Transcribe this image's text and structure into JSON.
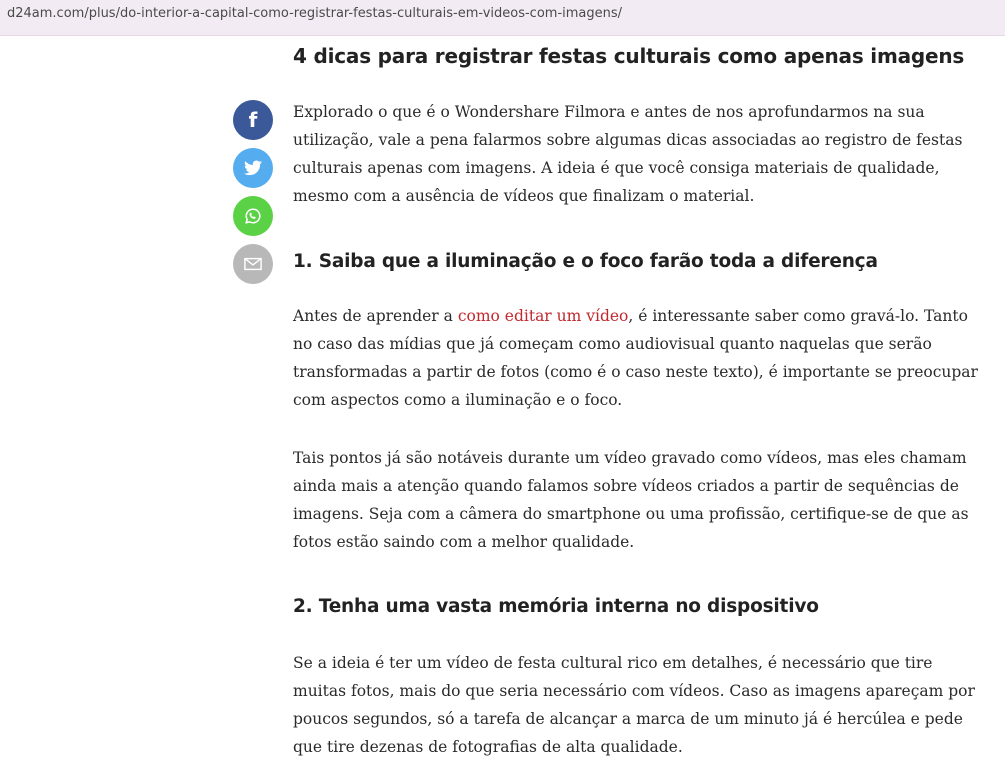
{
  "browser": {
    "url": "d24am.com/plus/do-interior-a-capital-como-registrar-festas-culturais-em-videos-com-imagens/"
  },
  "share": [
    {
      "name": "facebook-icon",
      "glyph": "f",
      "color": "#3b5998"
    },
    {
      "name": "twitter-icon",
      "color": "#55acee"
    },
    {
      "name": "whatsapp-icon",
      "color": "#5bd146"
    },
    {
      "name": "email-icon",
      "color": "#b8b8b8"
    }
  ],
  "article": {
    "heading": "4 dicas para registrar festas culturais como apenas imagens",
    "intro": "Explorado o que é o Wondershare Filmora e antes de nos aprofundarmos na sua utilização, vale a pena falarmos sobre algumas dicas associadas ao registro de festas culturais apenas com imagens. A ideia é que você consiga materiais de qualidade, mesmo com a ausência de vídeos que finalizam o material.",
    "section1": {
      "title": "1. Saiba que a iluminação e o foco farão toda a diferença",
      "p1_before": "Antes de aprender a ",
      "p1_link": "como editar um vídeo",
      "p1_after": ", é interessante saber como gravá-lo. Tanto no caso das mídias que já começam como audiovisual quanto naquelas que serão transformadas a partir de fotos (como é o caso neste texto), é importante se preocupar com aspectos como a iluminação e o foco.",
      "p2": "Tais pontos já são notáveis durante um vídeo gravado como vídeos, mas eles chamam ainda mais a atenção quando falamos sobre vídeos criados a partir de sequências de imagens. Seja com a câmera do smartphone ou uma profissão, certifique-se de que as fotos estão saindo com a melhor qualidade."
    },
    "section2": {
      "title": "2. Tenha uma vasta memória interna no dispositivo",
      "p1": "Se a ideia é ter um vídeo de festa cultural rico em detalhes, é necessário que tire muitas fotos, mais do que seria necessário com vídeos. Caso as imagens apareçam por poucos segundos, só a tarefa de alcançar a marca de um minuto já é hercúlea e pede que tire dezenas de fotografias de alta qualidade."
    },
    "link_color": "#c1272d"
  }
}
